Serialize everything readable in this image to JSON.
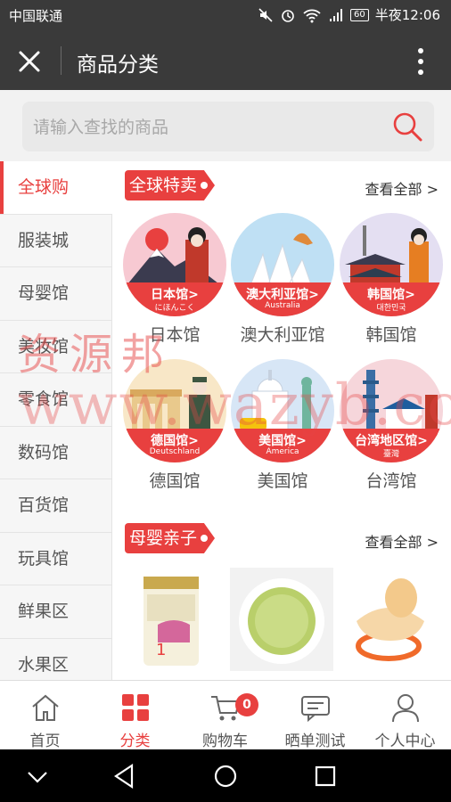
{
  "status_bar": {
    "carrier": "中国联通",
    "battery": "60",
    "time": "半夜12:06",
    "icons": [
      "mute-icon",
      "alarm-icon",
      "wifi-icon",
      "signal-icon",
      "battery-icon"
    ]
  },
  "app_bar": {
    "title": "商品分类",
    "close_icon": "close-icon",
    "more_icon": "more-vert-icon"
  },
  "search": {
    "placeholder": "请输入查找的商品",
    "icon": "search-icon"
  },
  "sidebar": {
    "items": [
      {
        "label": "全球购",
        "active": true
      },
      {
        "label": "服装城",
        "active": false
      },
      {
        "label": "母婴馆",
        "active": false
      },
      {
        "label": "美妆馆",
        "active": false
      },
      {
        "label": "零食馆",
        "active": false
      },
      {
        "label": "数码馆",
        "active": false
      },
      {
        "label": "百货馆",
        "active": false
      },
      {
        "label": "玩具馆",
        "active": false
      },
      {
        "label": "鲜果区",
        "active": false
      },
      {
        "label": "水果区",
        "active": false
      }
    ]
  },
  "sections": [
    {
      "title": "全球特卖",
      "view_all": "查看全部 >",
      "items": [
        {
          "badge": "日本馆>",
          "sub": "にほんこく",
          "name": "日本馆"
        },
        {
          "badge": "澳大利亚馆>",
          "sub": "Australia",
          "name": "澳大利亚馆"
        },
        {
          "badge": "韩国馆>",
          "sub": "대한민국",
          "name": "韩国馆"
        },
        {
          "badge": "德国馆>",
          "sub": "Deutschland",
          "name": "德国馆"
        },
        {
          "badge": "美国馆>",
          "sub": "America",
          "name": "美国馆"
        },
        {
          "badge": "台湾地区馆>",
          "sub": "臺灣",
          "name": "台湾馆"
        }
      ]
    },
    {
      "title": "母婴亲子",
      "view_all": "查看全部 >",
      "products": [
        {
          "image": "formula-can-image"
        },
        {
          "image": "baby-porridge-bowl-image"
        },
        {
          "image": "pacifier-image"
        }
      ]
    }
  ],
  "watermark": {
    "line1": "资源邦",
    "line2": "www.wazyb.com"
  },
  "tab_bar": {
    "tabs": [
      {
        "label": "首页",
        "icon": "home-icon",
        "active": false
      },
      {
        "label": "分类",
        "icon": "category-grid-icon",
        "active": true
      },
      {
        "label": "购物车",
        "icon": "cart-icon",
        "active": false
      },
      {
        "label": "晒单测试",
        "icon": "chat-icon",
        "active": false
      },
      {
        "label": "个人中心",
        "icon": "user-icon",
        "active": false
      }
    ],
    "cart_badge": "0"
  },
  "nav_bar": {
    "buttons": [
      "hide-keyboard-icon",
      "back-icon",
      "home-circle-icon",
      "recents-icon"
    ]
  },
  "colors": {
    "accent": "#e8403f",
    "bar": "#3a3a3a"
  }
}
